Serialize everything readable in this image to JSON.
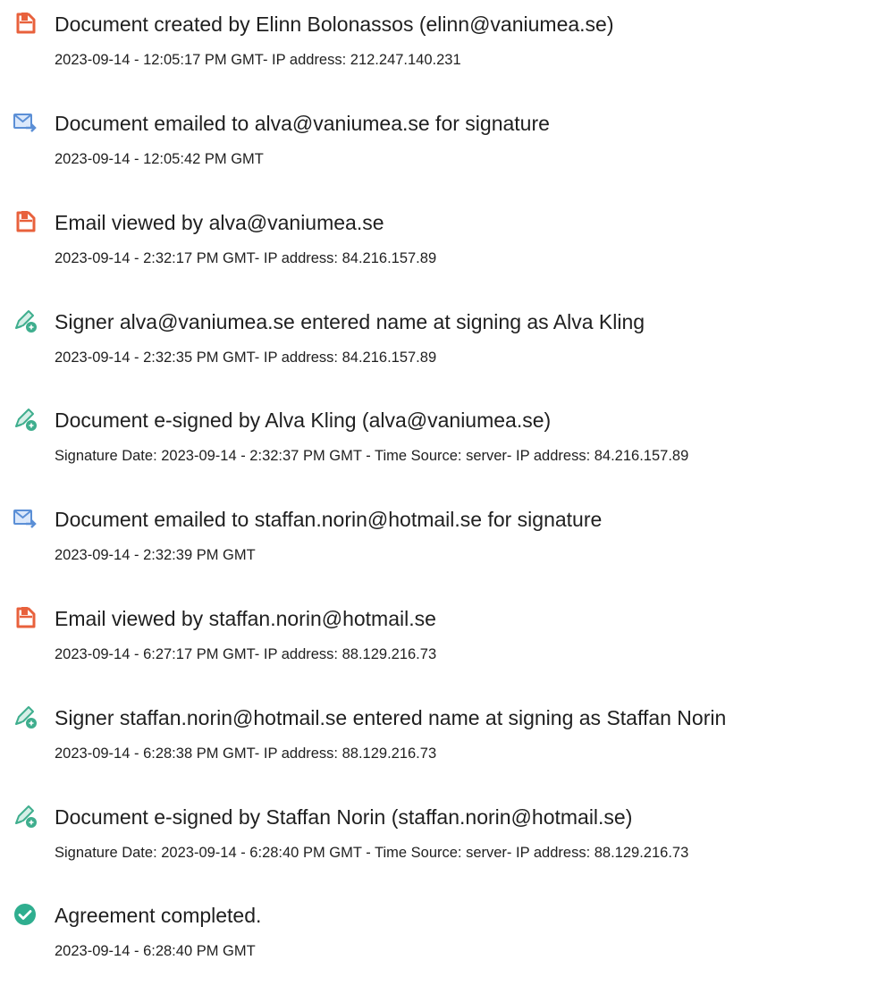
{
  "events": [
    {
      "icon": "document-icon",
      "title": "Document created by Elinn Bolonassos (elinn@vaniumea.se)",
      "detail": "2023-09-14 - 12:05:17 PM GMT- IP address: 212.247.140.231"
    },
    {
      "icon": "email-send-icon",
      "title": "Document emailed to alva@vaniumea.se for signature",
      "detail": "2023-09-14 - 12:05:42 PM GMT"
    },
    {
      "icon": "document-icon",
      "title": "Email viewed by alva@vaniumea.se",
      "detail": "2023-09-14 - 2:32:17 PM GMT- IP address: 84.216.157.89"
    },
    {
      "icon": "signature-pen-icon",
      "title": "Signer alva@vaniumea.se entered name at signing as Alva Kling",
      "detail": "2023-09-14 - 2:32:35 PM GMT- IP address: 84.216.157.89"
    },
    {
      "icon": "signature-pen-icon",
      "title": "Document e-signed by Alva Kling (alva@vaniumea.se)",
      "detail": "Signature Date: 2023-09-14 - 2:32:37 PM GMT - Time Source: server- IP address: 84.216.157.89"
    },
    {
      "icon": "email-send-icon",
      "title": "Document emailed to staffan.norin@hotmail.se for signature",
      "detail": "2023-09-14 - 2:32:39 PM GMT"
    },
    {
      "icon": "document-icon",
      "title": "Email viewed by staffan.norin@hotmail.se",
      "detail": "2023-09-14 - 6:27:17 PM GMT- IP address: 88.129.216.73"
    },
    {
      "icon": "signature-pen-icon",
      "title": "Signer staffan.norin@hotmail.se entered name at signing as Staffan Norin",
      "detail": "2023-09-14 - 6:28:38 PM GMT- IP address: 88.129.216.73"
    },
    {
      "icon": "signature-pen-icon",
      "title": "Document e-signed by Staffan Norin (staffan.norin@hotmail.se)",
      "detail": "Signature Date: 2023-09-14 - 6:28:40 PM GMT - Time Source: server- IP address: 88.129.216.73"
    },
    {
      "icon": "checkmark-circle-icon",
      "title": "Agreement completed.",
      "detail": "2023-09-14 - 6:28:40 PM GMT"
    }
  ],
  "colors": {
    "document_icon": "#e8613c",
    "email_icon": "#5b8fd6",
    "signature_icon": "#3fae8e",
    "check_icon": "#2fae8f",
    "text": "#1f1f1f"
  }
}
